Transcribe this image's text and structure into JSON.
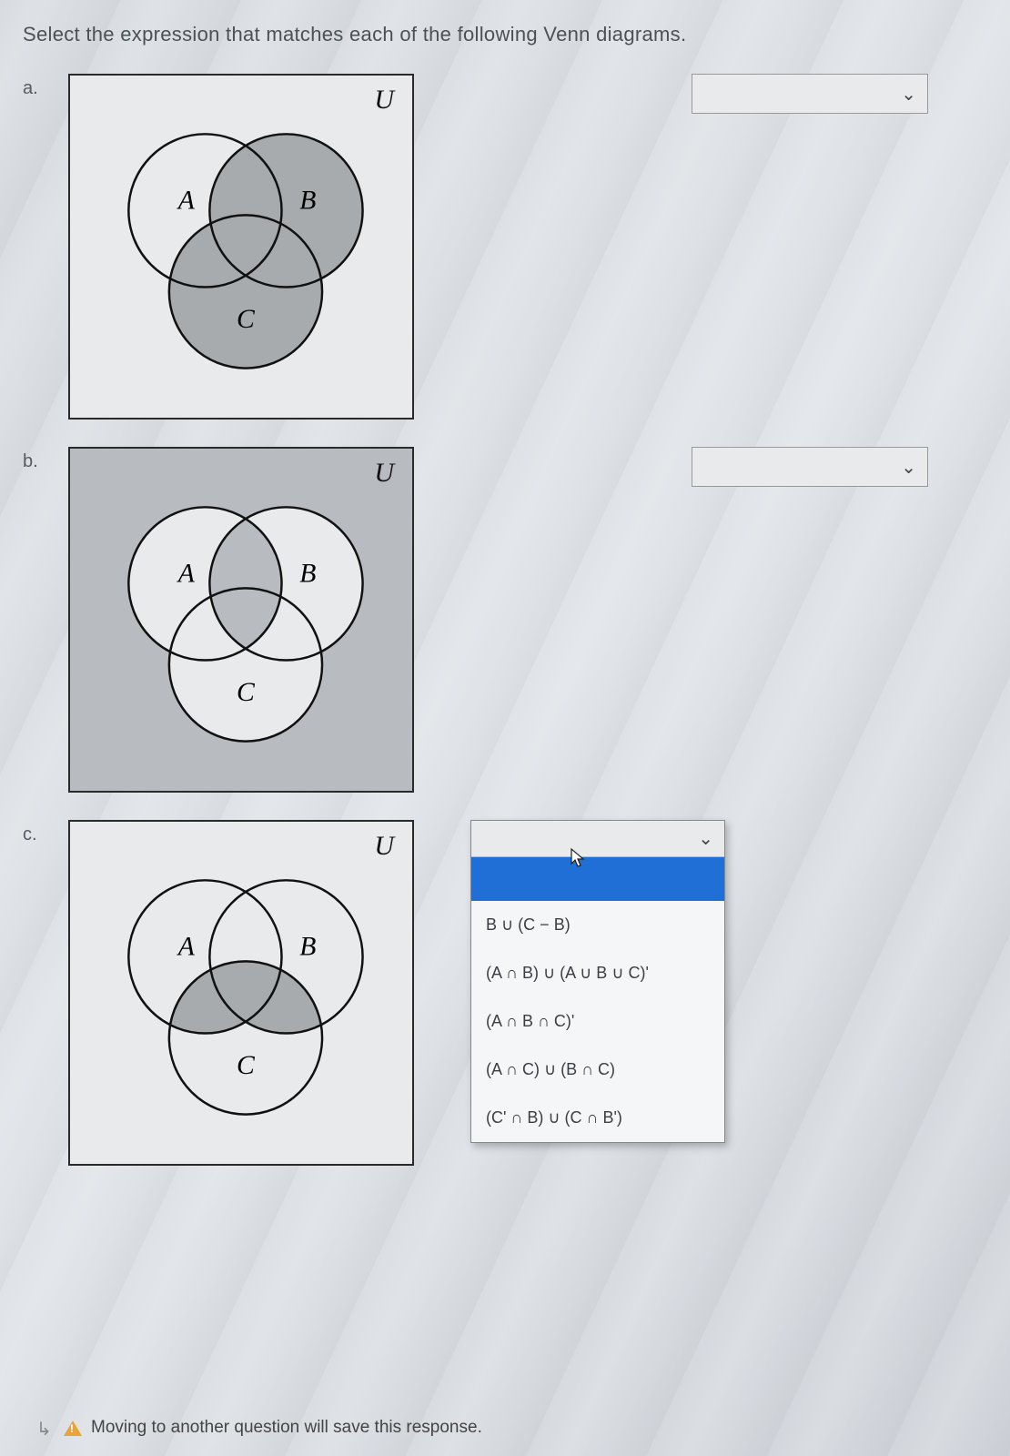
{
  "prompt": "Select the expression that matches each of the following Venn diagrams.",
  "labels": {
    "a": "a.",
    "b": "b.",
    "c": "c.",
    "u": "U",
    "A": "A",
    "B": "B",
    "C": "C"
  },
  "dropdown": {
    "options": [
      "B ∪ (C − B)",
      "(A ∩ B) ∪ (A ∪ B ∪ C)'",
      "(A ∩ B ∩ C)'",
      "(A ∩ C) ∪ (B ∩ C)",
      "(C' ∩ B) ∪ (C ∩ B')"
    ]
  },
  "footer": "Moving to another question will save this response.",
  "chev": "⌄"
}
